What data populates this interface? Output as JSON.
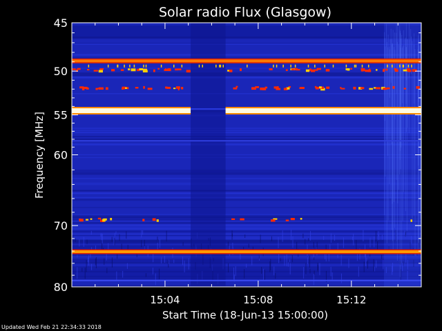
{
  "chart_data": {
    "type": "heatmap",
    "title": "Solar radio Flux (Glasgow)",
    "xlabel": "Start Time (18-Jun-13 15:00:00)",
    "ylabel": "Frequency [MHz]",
    "x_unit": "minutes after 15:00:00",
    "xlim": [
      0,
      15
    ],
    "ylim": [
      45,
      80
    ],
    "y_scale": "log",
    "y_inverted": true,
    "x_ticks": [
      {
        "value": 4,
        "label": "15:04"
      },
      {
        "value": 8,
        "label": "15:08"
      },
      {
        "value": 12,
        "label": "15:12"
      }
    ],
    "y_ticks": [
      {
        "value": 45,
        "label": "45"
      },
      {
        "value": 50,
        "label": "50"
      },
      {
        "value": 55,
        "label": "55"
      },
      {
        "value": 60,
        "label": "60"
      },
      {
        "value": 70,
        "label": "70"
      },
      {
        "value": 80,
        "label": "80"
      }
    ],
    "colormap": [
      "#000066",
      "#1020c0",
      "#2a3ae0",
      "#ff2000",
      "#ffd000",
      "#ffffff"
    ],
    "background_color": "#1a26b8",
    "bands": [
      {
        "freq": 48.9,
        "x_from": 0,
        "x_to": 15,
        "intensity": "high",
        "color": "#ff7a00"
      },
      {
        "freq": 54.5,
        "x_from": 0,
        "x_to": 5.1,
        "intensity": "saturated",
        "color": "#fffbe0"
      },
      {
        "freq": 54.3,
        "x_from": 5.1,
        "x_to": 6.6,
        "intensity": "low",
        "color": "#2a3ae0"
      },
      {
        "freq": 54.5,
        "x_from": 6.6,
        "x_to": 15,
        "intensity": "saturated",
        "color": "#fffbe0"
      },
      {
        "freq": 74.1,
        "x_from": 0,
        "x_to": 15,
        "intensity": "high",
        "color": "#ff9a00"
      },
      {
        "freq": 78.9,
        "x_from": 0,
        "x_to": 15,
        "intensity": "low",
        "color": "#3a4af0"
      },
      {
        "freq": 58.2,
        "x_from": 0,
        "x_to": 15,
        "intensity": "low",
        "color": "#3040e0"
      }
    ],
    "bursts": [
      {
        "freq": 49.8,
        "intensity": "medium"
      },
      {
        "freq": 51.8,
        "intensity": "medium"
      },
      {
        "freq": 69.0,
        "intensity": "low"
      }
    ],
    "gap_interval": [
      5.1,
      6.6
    ]
  },
  "footer": {
    "updated_text": "Updated Wed Feb 21 22:34:33 2018"
  }
}
